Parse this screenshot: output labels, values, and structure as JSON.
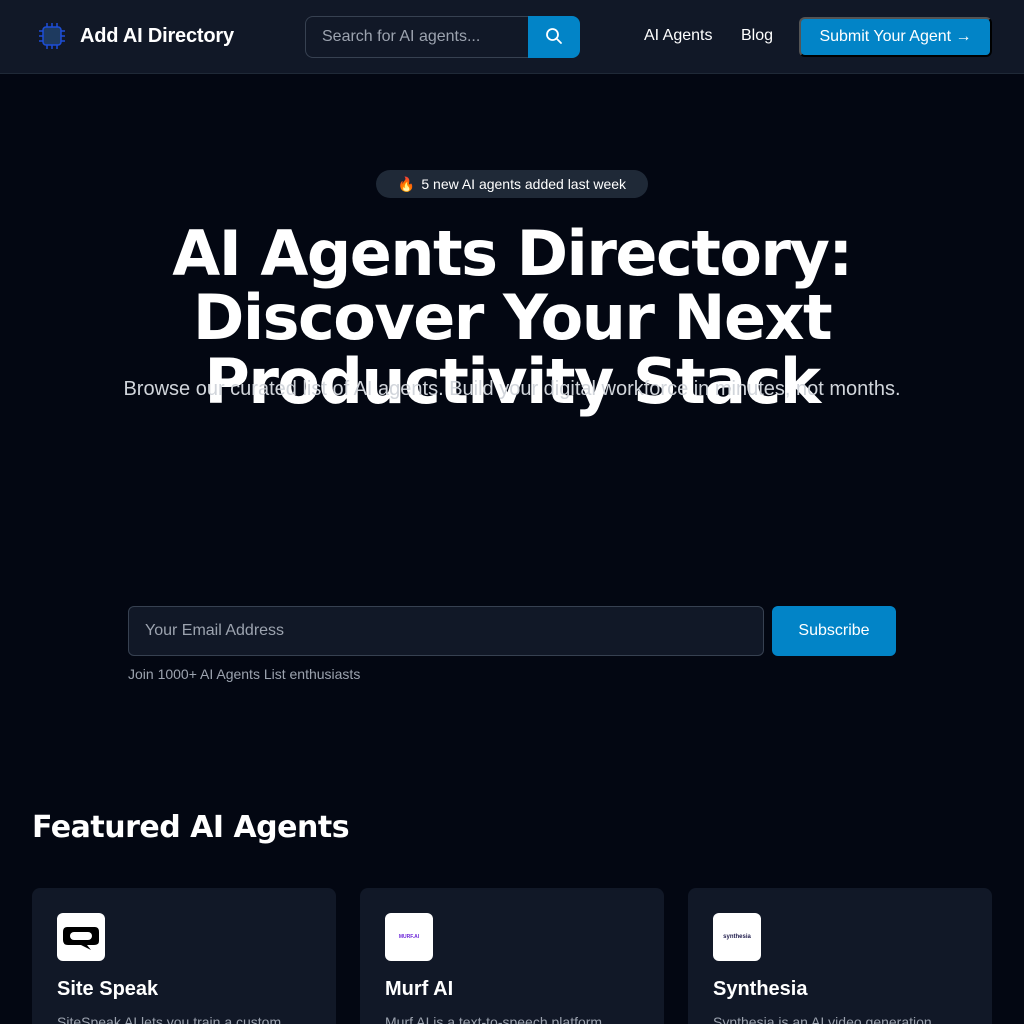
{
  "header": {
    "logo_text": "Add AI Directory",
    "logo_icon": "ai-chip-icon",
    "search_placeholder": "Search for AI agents...",
    "nav": [
      {
        "label": "AI Agents"
      },
      {
        "label": "Blog"
      }
    ],
    "submit_label": "Submit Your Agent →"
  },
  "hero": {
    "badge_emoji": "🔥",
    "badge_text": "5 new AI agents added last week",
    "title": "AI Agents Directory: Discover Your Next Productivity Stack",
    "subtitle": "Browse our curated list of AI agents. Build your digital workforce in minutes, not months."
  },
  "newsletter": {
    "email_placeholder": "Your Email Address",
    "subscribe_label": "Subscribe",
    "join_text": "Join 1000+ AI Agents List enthusiasts"
  },
  "featured": {
    "title": "Featured AI Agents",
    "cards": [
      {
        "name": "Site Speak",
        "description": "SiteSpeak AI lets you train a custom",
        "logo": "sitespeak-logo"
      },
      {
        "name": "Murf AI",
        "description": "Murf AI is a text-to-speech platform",
        "logo": "murf-logo",
        "logo_text": "MURF.AI"
      },
      {
        "name": "Synthesia",
        "description": "Synthesia is an AI video generation",
        "logo": "synthesia-logo",
        "logo_text": "synthesia"
      }
    ]
  },
  "colors": {
    "background": "#030712",
    "header_bg": "#111827",
    "accent": "#0284c7",
    "card_bg": "#111827"
  }
}
